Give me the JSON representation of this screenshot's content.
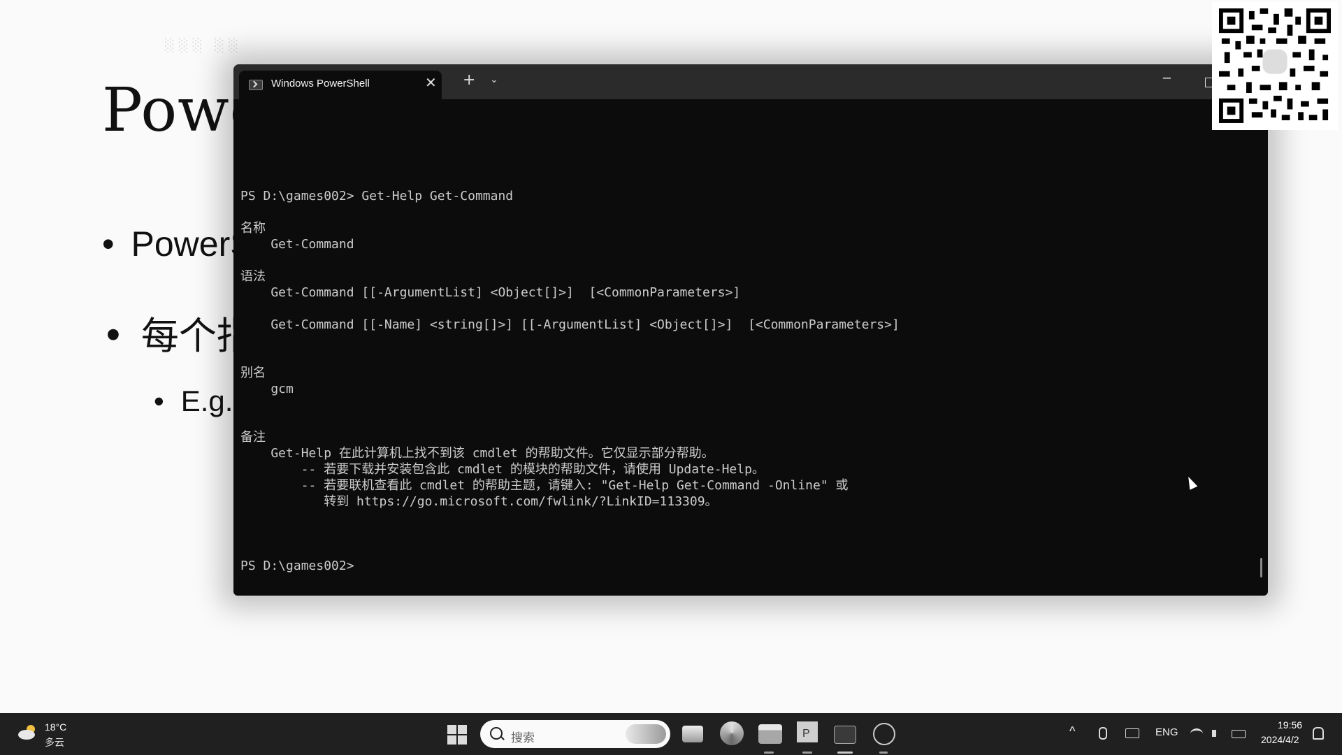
{
  "slide": {
    "title": "Powe",
    "bullet1": "PowerS",
    "bullet2": "每个指",
    "bullet3": "E.g.",
    "bullet_symbol": "•"
  },
  "terminal": {
    "tab_title": "Windows PowerShell",
    "close_glyph": "✕",
    "new_tab_glyph": "+",
    "dropdown_glyph": "⌄",
    "minimize_glyph": "─",
    "lines": [
      "",
      "",
      "",
      "",
      "",
      "PS D:\\games002> Get-Help Get-Command",
      "",
      "名称",
      "    Get-Command",
      "",
      "语法",
      "    Get-Command [[-ArgumentList] <Object[]>]  [<CommonParameters>]",
      "",
      "    Get-Command [[-Name] <string[]>] [[-ArgumentList] <Object[]>]  [<CommonParameters>]",
      "",
      "",
      "别名",
      "    gcm",
      "",
      "",
      "备注",
      "    Get-Help 在此计算机上找不到该 cmdlet 的帮助文件。它仅显示部分帮助。",
      "        -- 若要下载并安装包含此 cmdlet 的模块的帮助文件，请使用 Update-Help。",
      "        -- 若要联机查看此 cmdlet 的帮助主题，请键入: \"Get-Help Get-Command -Online\" 或",
      "           转到 https://go.microsoft.com/fwlink/?LinkID=113309。",
      "",
      "",
      "",
      "PS D:\\games002>"
    ]
  },
  "taskbar": {
    "weather_temp": "18°C",
    "weather_desc": "多云",
    "search_placeholder": "搜索",
    "tray_chevron": "^",
    "language": "ENG",
    "time": "19:56",
    "date": "2024/4/2"
  },
  "colors": {
    "terminal_bg": "#0c0c0c",
    "terminal_text": "#cccccc",
    "titlebar_bg": "#2b2b2b",
    "taskbar_bg": "#202020"
  },
  "icons": [
    "powershell-icon",
    "close-icon",
    "plus-icon",
    "chevron-down-icon",
    "minimize-icon",
    "maximize-icon",
    "qr-code",
    "weather-icon",
    "windows-start-icon",
    "search-icon",
    "task-view-icon",
    "edge-icon",
    "file-explorer-icon",
    "powerpoint-icon",
    "terminal-icon",
    "obs-icon",
    "microphone-icon",
    "keyboard-icon",
    "wifi-icon",
    "volume-icon",
    "battery-icon",
    "notification-bell-icon"
  ]
}
